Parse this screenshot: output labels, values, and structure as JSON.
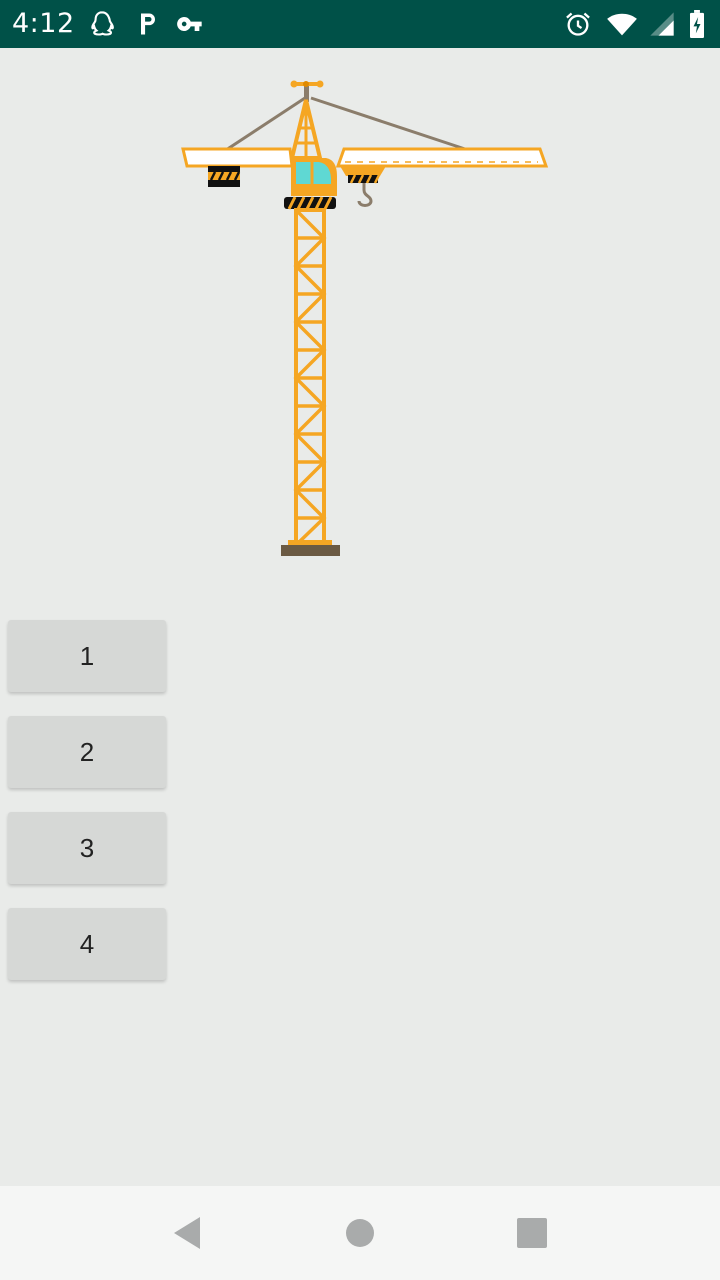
{
  "status_bar": {
    "time": "4:12",
    "left_icons": [
      "qq-penguin-icon",
      "parking-p-icon",
      "vpn-key-icon"
    ],
    "right_icons": [
      "alarm-clock-icon",
      "wifi-icon",
      "signal-icon",
      "battery-charging-icon"
    ],
    "background": "#005148"
  },
  "illustration": {
    "name": "tower-crane",
    "accent": "#f5a623"
  },
  "buttons": [
    {
      "label": "1"
    },
    {
      "label": "2"
    },
    {
      "label": "3"
    },
    {
      "label": "4"
    }
  ],
  "nav_bar": {
    "buttons": [
      "back-icon",
      "home-icon",
      "recents-icon"
    ]
  }
}
